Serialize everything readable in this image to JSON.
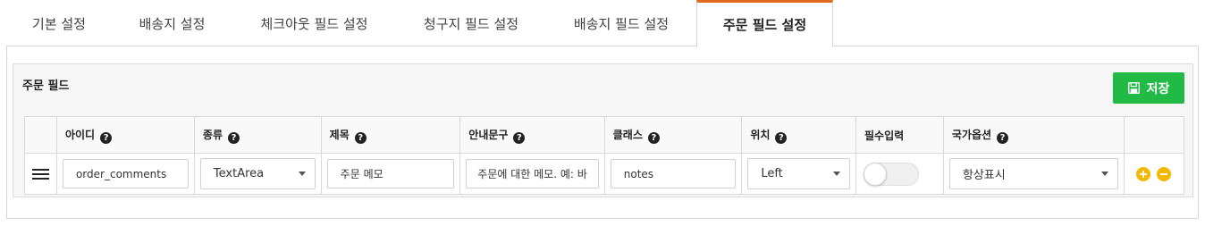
{
  "tabs": [
    {
      "label": "기본 설정"
    },
    {
      "label": "배송지 설정"
    },
    {
      "label": "체크아웃 필드 설정"
    },
    {
      "label": "청구지 필드 설정"
    },
    {
      "label": "배송지 필드 설정"
    },
    {
      "label": "주문 필드 설정"
    }
  ],
  "active_tab": "주문 필드 설정",
  "section": {
    "title": "주문 필드",
    "save_label": "저장"
  },
  "table": {
    "headers": {
      "id": "아이디",
      "type": "종류",
      "title": "제목",
      "placeholder": "안내문구",
      "class": "클래스",
      "position": "위치",
      "required": "필수입력",
      "country": "국가옵션"
    },
    "help_glyph": "?",
    "row": {
      "id": "order_comments",
      "type": "TextArea",
      "title": "주문 메모",
      "placeholder": "주문에 대한 메모. 예: 바",
      "class": "notes",
      "position": "Left",
      "required": false,
      "country": "항상표시"
    }
  },
  "colors": {
    "active_tab_accent": "#e06b1f",
    "save_button": "#21ba45",
    "row_action_buttons": "#f5b800"
  },
  "icons": {
    "save": "floppy-disk-icon",
    "help": "question-circle-icon",
    "drag": "drag-handle-icon",
    "add": "plus-circle-icon",
    "remove": "minus-circle-icon"
  }
}
